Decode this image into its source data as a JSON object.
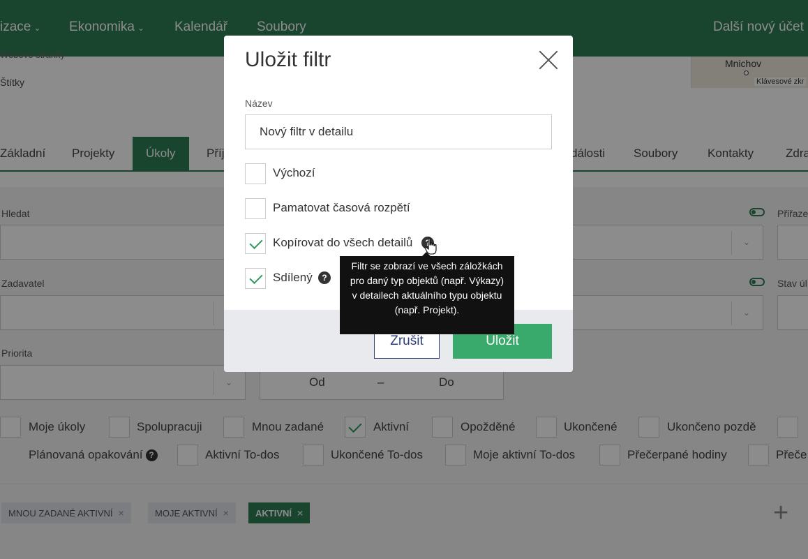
{
  "topnav": {
    "items": [
      {
        "label": "izace",
        "has_caret": true
      },
      {
        "label": "Ekonomika",
        "has_caret": true
      },
      {
        "label": "Kalendář",
        "has_caret": false
      },
      {
        "label": "Soubory",
        "has_caret": false
      }
    ],
    "right_label": "Další nový účet",
    "caret_glyph": "⌄"
  },
  "subhead": {
    "peek_text": "Webové stránky",
    "tags_label": "Štítky",
    "map": {
      "city": "Mnichov",
      "keyboard_hint": "Klávesové zkr"
    }
  },
  "tabs": [
    "Základní",
    "Projekty",
    "Úkoly",
    "Příj",
    "dálosti",
    "Soubory",
    "Kontakty",
    "Zdra"
  ],
  "active_tab": "Úkoly",
  "filters": {
    "search_label": "Hledat",
    "requester_label": "Zadavatel",
    "priority_label": "Priorita",
    "assigned_label": "Přiřaze",
    "state_label": "Stav úl",
    "range_from": "Od",
    "range_to": "Do",
    "range_dash": "–",
    "checkboxes_row1": [
      {
        "label": "Moje úkoly",
        "checked": false
      },
      {
        "label": "Spolupracuji",
        "checked": false
      },
      {
        "label": "Mnou zadané",
        "checked": false
      },
      {
        "label": "Aktivní",
        "checked": true
      },
      {
        "label": "Opožděné",
        "checked": false
      },
      {
        "label": "Ukončené",
        "checked": false
      },
      {
        "label": "Ukončeno pozdě",
        "checked": false
      }
    ],
    "checkboxes_row2": [
      {
        "label": "Plánovaná opakování",
        "checked": false,
        "help": true
      },
      {
        "label": "Aktivní To-dos",
        "checked": false
      },
      {
        "label": "Ukončené To-dos",
        "checked": false
      },
      {
        "label": "Moje aktivní To-dos",
        "checked": false
      },
      {
        "label": "Přečerpané hodiny",
        "checked": false
      },
      {
        "label": "Přeče",
        "checked": false
      }
    ]
  },
  "chips": [
    {
      "label": "MNOU ZADANÉ AKTIVNÍ",
      "active": false
    },
    {
      "label": "MOJE AKTIVNÍ",
      "active": false
    },
    {
      "label": "AKTIVNÍ",
      "active": true
    }
  ],
  "chip_remove_glyph": "×",
  "add_glyph": "+",
  "modal": {
    "title": "Uložit filtr",
    "name_label": "Název",
    "name_value": "Nový filtr v detailu",
    "options": [
      {
        "label": "Výchozí",
        "checked": false,
        "help": false
      },
      {
        "label": "Pamatovat časová rozpětí",
        "checked": false,
        "help": false
      },
      {
        "label": "Kopírovat do všech detailů",
        "checked": true,
        "help": true
      },
      {
        "label": "Sdílený",
        "checked": true,
        "help": true
      }
    ],
    "help_glyph": "?",
    "cancel_label": "Zrušit",
    "save_label": "Uložit"
  },
  "tooltip": {
    "text": "Filtr se zobrazí ve všech záložkách pro daný typ objektů (např. Výkazy) v detailech aktuálního typu objektu (např. Projekt)."
  },
  "colors": {
    "brand_green": "#2e7d55",
    "save_green": "#3aaa6c",
    "cancel_navy": "#2e3f7a",
    "overlay": "rgba(0,0,0,0.45)"
  }
}
